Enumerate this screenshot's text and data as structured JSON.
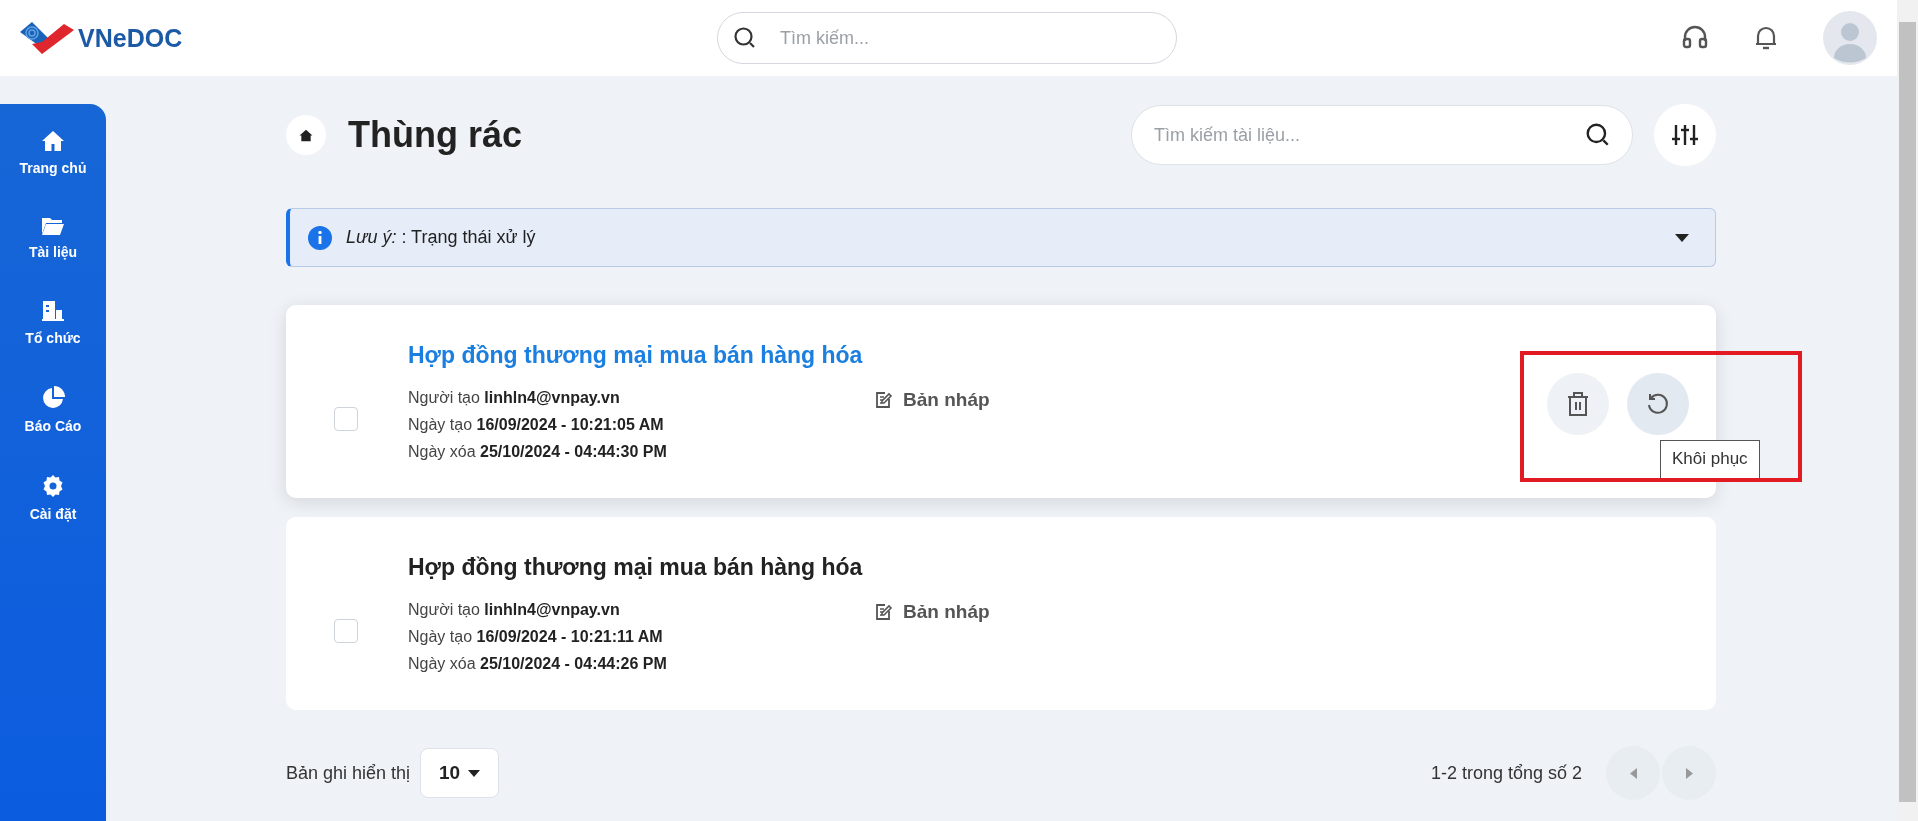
{
  "header": {
    "logo_text": "VNeDOC",
    "search": {
      "placeholder": "Tìm kiếm..."
    }
  },
  "sidebar": {
    "items": [
      {
        "label": "Trang chủ",
        "selected": false
      },
      {
        "label": "Tài liệu",
        "selected": false
      },
      {
        "label": "Tổ chức",
        "selected": false
      },
      {
        "label": "Báo Cáo",
        "selected": false
      },
      {
        "label": "Cài đặt",
        "selected": false
      }
    ]
  },
  "page": {
    "title": "Thùng rác",
    "search": {
      "placeholder": "Tìm kiếm tài liệu..."
    }
  },
  "notice": {
    "text": "*Lưu ý:* : Trạng thái xử lý",
    "expanded": false
  },
  "documents": [
    {
      "title": "Hợp đồng thương mại mua bán hàng hóa",
      "checked": false,
      "selected": true,
      "meta": [
        "Người tạo **linhln4@vnpay.vn**",
        "Ngày tạo **16/09/2024 - 10:21:05 AM**",
        "Ngày xóa **25/10/2024 - 04:44:30 PM**"
      ],
      "status": "Bản nháp",
      "tooltip": "Khôi phục"
    },
    {
      "title": "Hợp đồng thương mại mua bán hàng hóa",
      "checked": false,
      "selected": false,
      "meta": [
        "Người tạo **linhln4@vnpay.vn**",
        "Ngày tạo **16/09/2024 - 10:21:11 AM**",
        "Ngày xóa **25/10/2024 - 04:44:26 PM**"
      ],
      "status": "Bản nháp"
    }
  ],
  "pagination": {
    "page_size_label": "Bản ghi hiển thị",
    "page_size": "10",
    "range": "1-2 trong tổng số 2"
  }
}
